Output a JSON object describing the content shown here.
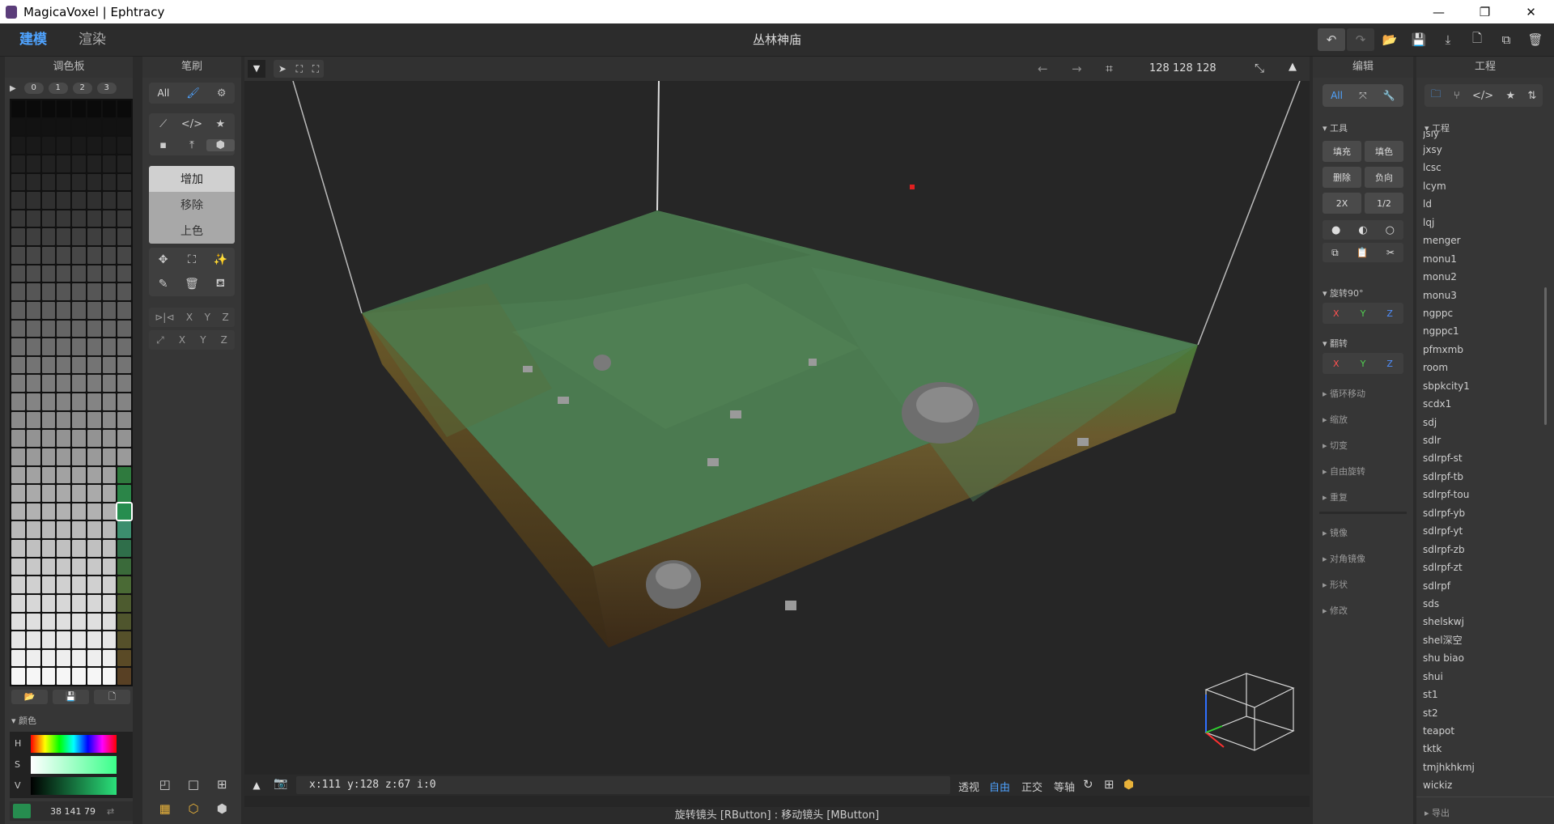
{
  "window": {
    "title": "MagicaVoxel | Ephtracy",
    "minimize": "—",
    "maximize": "❐",
    "close": "✕"
  },
  "topbar": {
    "mode_model": "建模",
    "mode_render": "渲染",
    "project_title": "丛林神庙",
    "icons": [
      "undo-icon",
      "redo-icon",
      "open-folder-icon",
      "save-icon",
      "export-icon",
      "new-file-icon",
      "copy-file-icon",
      "delete-file-icon"
    ],
    "glyphs": [
      "↶",
      "↷",
      "📂",
      "💾",
      "⤓",
      "🗋",
      "⧉",
      "🗑"
    ]
  },
  "palette": {
    "header": "调色板",
    "tabs": [
      "0",
      "1",
      "2",
      "3"
    ],
    "play": "▶",
    "buttons": [
      "📂",
      "💾",
      "🗋"
    ],
    "color_section": "▾ 颜色",
    "hsv_labels": [
      "H",
      "S",
      "V"
    ],
    "rgb": "38  141  79",
    "current_color": "#268d4f"
  },
  "brush": {
    "header": "笔刷",
    "all_label": "All",
    "modes": [
      "增加",
      "移除",
      "上色"
    ],
    "mirror_axes": [
      "X",
      "Y",
      "Z"
    ],
    "scale_axes": [
      "X",
      "Y",
      "Z"
    ]
  },
  "viewport": {
    "dims": "128  128  128",
    "coords": "x:111  y:128  z:67    i:0",
    "views": [
      "透视",
      "自由",
      "正交",
      "等轴"
    ],
    "active_view": "自由"
  },
  "edit": {
    "header": "编辑",
    "all_label": "All",
    "tools_section": "▾ 工具",
    "tool_buttons": [
      "填充",
      "填色",
      "删除",
      "负向",
      "2X",
      "1/2"
    ],
    "rotate_section": "▾ 旋转90°",
    "flip_section": "▾ 翻转",
    "axes": [
      "X",
      "Y",
      "Z"
    ],
    "collapsed_sections": [
      "▸ 循环移动",
      "▸ 缩放",
      "▸ 切变",
      "▸ 自由旋转",
      "▸ 重复",
      "▸ 镜像",
      "▸ 对角镜像",
      "▸ 形状",
      "▸ 修改"
    ]
  },
  "project": {
    "header": "工程",
    "section": "▾ 工程",
    "files": [
      "jsly",
      "jxsy",
      "lcsc",
      "lcym",
      "ld",
      "lqj",
      "menger",
      "monu1",
      "monu2",
      "monu3",
      "ngppc",
      "ngppc1",
      "pfmxmb",
      "room",
      "sbpkcity1",
      "scdx1",
      "sdj",
      "sdlr",
      "sdlrpf-st",
      "sdlrpf-tb",
      "sdlrpf-tou",
      "sdlrpf-yb",
      "sdlrpf-yt",
      "sdlrpf-zb",
      "sdlrpf-zt",
      "sdlrpf",
      "sds",
      "shelskwj",
      "shel深空",
      "shu biao",
      "shui",
      "st1",
      "st2",
      "teapot",
      "tktk",
      "tmjhkhkmj",
      "wickiz"
    ],
    "export_label": "▸ 导出"
  },
  "status": "旋转镜头 [RButton] : 移动镜头 [MButton]"
}
